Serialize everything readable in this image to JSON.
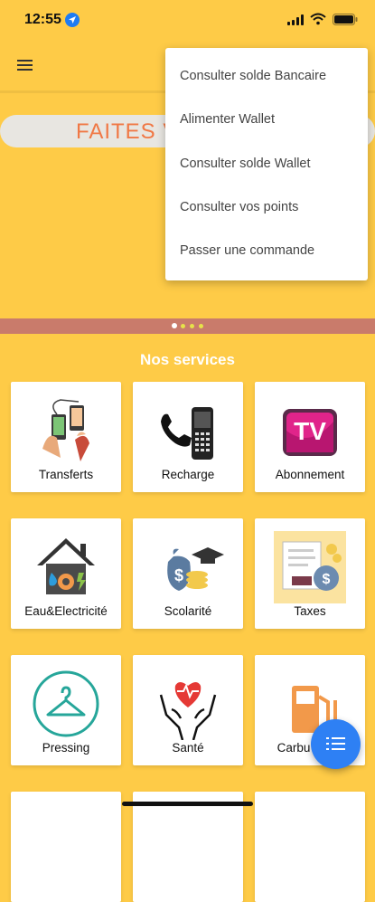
{
  "status": {
    "time": "12:55"
  },
  "menu_icon": "menu-icon",
  "banner": {
    "text": "FAITES V"
  },
  "section_title": "Nos services",
  "services": [
    {
      "label": "Transferts",
      "icon": "transfer-icon"
    },
    {
      "label": "Recharge",
      "icon": "phone-recharge-icon"
    },
    {
      "label": "Abonnement",
      "icon": "tv-icon"
    },
    {
      "label": "Eau&Electricité",
      "icon": "house-utilities-icon"
    },
    {
      "label": "Scolarité",
      "icon": "graduation-money-icon"
    },
    {
      "label": "Taxes",
      "icon": "tax-document-icon"
    },
    {
      "label": "Pressing",
      "icon": "hanger-icon"
    },
    {
      "label": "Santé",
      "icon": "heart-hands-icon"
    },
    {
      "label": "Carbu",
      "icon": "fuel-pump-icon"
    }
  ],
  "dropdown": {
    "items": [
      "Consulter solde Bancaire",
      "Alimenter Wallet",
      "Consulter solde Wallet",
      "Consulter vos points",
      "Passer une commande"
    ]
  },
  "fab_icon": "list-icon",
  "colors": {
    "background": "#FECB47",
    "accent": "#2E80F4",
    "banner_text": "#F07845"
  }
}
